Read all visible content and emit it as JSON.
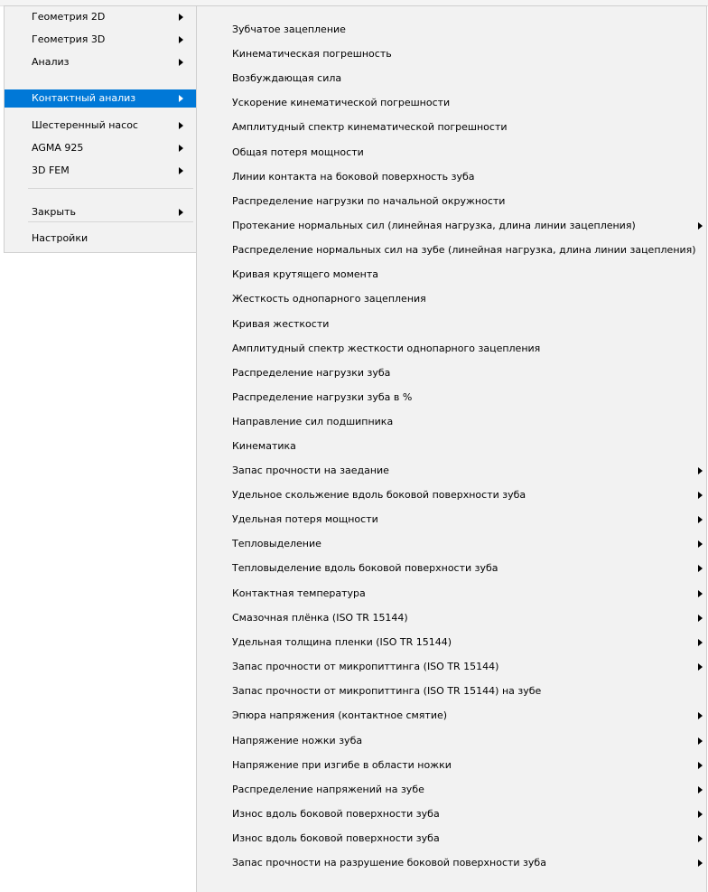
{
  "main_menu": {
    "items": [
      {
        "label": "Геометрия 2D",
        "submenu": true
      },
      {
        "label": "Геометрия 3D",
        "submenu": true
      },
      {
        "label": "Анализ",
        "submenu": true
      },
      {
        "label": "Контактный анализ",
        "submenu": true,
        "highlighted": true
      },
      {
        "label": "Шестеренный насос",
        "submenu": true
      },
      {
        "label": "AGMA 925",
        "submenu": true
      },
      {
        "label": "3D FEM",
        "submenu": true
      },
      {
        "label": "Закрыть",
        "submenu": true
      },
      {
        "label": "Настройки",
        "submenu": false
      }
    ]
  },
  "submenu": {
    "items": [
      {
        "label": "Зубчатое зацепление",
        "submenu": false
      },
      {
        "label": "Кинематическая погрешность",
        "submenu": false
      },
      {
        "label": "Возбуждающая сила",
        "submenu": false
      },
      {
        "label": "Ускорение кинематической погрешности",
        "submenu": false
      },
      {
        "label": "Амплитудный спектр кинематической погрешности",
        "submenu": false
      },
      {
        "label": "Общая потеря мощности",
        "submenu": false
      },
      {
        "label": "Линии контакта на боковой поверхность зуба",
        "submenu": false
      },
      {
        "label": "Распределение нагрузки по начальной окружности",
        "submenu": false
      },
      {
        "label": "Протекание нормальных сил (линейная нагрузка, длина линии зацепления)",
        "submenu": true
      },
      {
        "label": "Распределение нормальных сил на зубе (линейная нагрузка, длина линии зацепления)",
        "submenu": false
      },
      {
        "label": "Кривая крутящего момента",
        "submenu": false
      },
      {
        "label": "Жесткость однопарного зацепления",
        "submenu": false
      },
      {
        "label": "Кривая жесткости",
        "submenu": false
      },
      {
        "label": "Амплитудный спектр жесткости однопарного зацепления",
        "submenu": false
      },
      {
        "label": "Распределение нагрузки зуба",
        "submenu": false
      },
      {
        "label": "Распределение нагрузки зуба в %",
        "submenu": false
      },
      {
        "label": "Направление сил подшипника",
        "submenu": false
      },
      {
        "label": "Кинематика",
        "submenu": false
      },
      {
        "label": "Запас прочности на заедание",
        "submenu": true
      },
      {
        "label": "Удельное скольжение вдоль боковой поверхности зуба",
        "submenu": true
      },
      {
        "label": "Удельная потеря мощности",
        "submenu": true
      },
      {
        "label": "Тепловыделение",
        "submenu": true
      },
      {
        "label": "Тепловыделение вдоль боковой поверхности зуба",
        "submenu": true
      },
      {
        "label": "Контактная температура",
        "submenu": true
      },
      {
        "label": "Смазочная плёнка (ISO TR 15144)",
        "submenu": true
      },
      {
        "label": "Удельная толщина пленки (ISO TR 15144)",
        "submenu": true
      },
      {
        "label": "Запас прочности от микропиттинга (ISO TR 15144)",
        "submenu": true
      },
      {
        "label": "Запас прочности от микропиттинга (ISO TR 15144) на зубе",
        "submenu": false
      },
      {
        "label": "Эпюра напряжения (контактное смятие)",
        "submenu": true
      },
      {
        "label": "Напряжение ножки зуба",
        "submenu": true
      },
      {
        "label": "Напряжение при изгибе в области ножки",
        "submenu": true
      },
      {
        "label": "Распределение напряжений на зубе",
        "submenu": true
      },
      {
        "label": "Износ вдоль боковой поверхности зуба",
        "submenu": true
      },
      {
        "label": "Износ вдоль боковой поверхности зуба",
        "submenu": true
      },
      {
        "label": "Запас прочности на разрушение боковой поверхности зуба",
        "submenu": true
      }
    ]
  },
  "colors": {
    "highlight": "#0078d7",
    "menu_background": "#f2f2f2"
  }
}
